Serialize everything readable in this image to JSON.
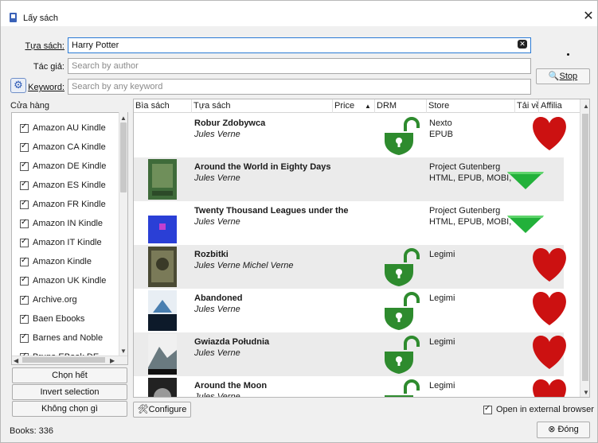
{
  "window": {
    "title": "Lấy sách"
  },
  "search": {
    "title_label": "Tựa sách:",
    "title_value": "Harry Potter",
    "author_label": "Tác giả:",
    "author_placeholder": "Search by author",
    "keyword_label": "Keyword:",
    "keyword_placeholder": "Search by any keyword",
    "stop_label": "Stop"
  },
  "stores": {
    "title": "Cửa hàng",
    "items": [
      {
        "label": "Amazon AU Kindle",
        "checked": true
      },
      {
        "label": "Amazon CA Kindle",
        "checked": true
      },
      {
        "label": "Amazon DE Kindle",
        "checked": true
      },
      {
        "label": "Amazon ES Kindle",
        "checked": true
      },
      {
        "label": "Amazon FR Kindle",
        "checked": true
      },
      {
        "label": "Amazon IN Kindle",
        "checked": true
      },
      {
        "label": "Amazon IT Kindle",
        "checked": true
      },
      {
        "label": "Amazon Kindle",
        "checked": true
      },
      {
        "label": "Amazon UK Kindle",
        "checked": true
      },
      {
        "label": "Archive.org",
        "checked": true
      },
      {
        "label": "Baen Ebooks",
        "checked": true
      },
      {
        "label": "Barnes and Noble",
        "checked": true
      },
      {
        "label": "Bruna EBook DE",
        "checked": true
      }
    ],
    "select_all": "Chọn hết",
    "invert_selection": "Invert selection",
    "select_none": "Không chọn gì"
  },
  "results": {
    "columns": [
      "Bìa sách",
      "Tựa sách",
      "Price",
      "DRM",
      "Store",
      "Tải về",
      "Affilia"
    ],
    "rows": [
      {
        "title": "Robur Zdobywca",
        "author": "Jules Verne",
        "store": "Nexto",
        "formats": "EPUB",
        "drm": "unlocked",
        "affiliate": true,
        "download": false,
        "cover": "none"
      },
      {
        "title": "Around the World in Eighty Days",
        "author": "Jules Verne",
        "store": "Project Gutenberg",
        "formats": "HTML, EPUB, MOBI, TXT",
        "drm": "none",
        "affiliate": false,
        "download": true,
        "cover": "green"
      },
      {
        "title": "Twenty Thousand Leagues under the",
        "author": "Jules Verne",
        "store": "Project Gutenberg",
        "formats": "HTML, EPUB, MOBI, TXT",
        "drm": "none",
        "affiliate": false,
        "download": true,
        "cover": "blue"
      },
      {
        "title": "Rozbitki",
        "author": "Jules Verne Michel Verne",
        "store": "Legimi",
        "formats": "",
        "drm": "unlocked",
        "affiliate": true,
        "download": false,
        "cover": "olive"
      },
      {
        "title": "Abandoned",
        "author": "Jules Verne",
        "store": "Legimi",
        "formats": "",
        "drm": "unlocked",
        "affiliate": true,
        "download": false,
        "cover": "sea"
      },
      {
        "title": "Gwiazda Południa",
        "author": "Jules Verne",
        "store": "Legimi",
        "formats": "",
        "drm": "unlocked",
        "affiliate": true,
        "download": false,
        "cover": "mountain"
      },
      {
        "title": "Around the Moon",
        "author": "Jules Verne",
        "store": "Legimi",
        "formats": "",
        "drm": "unlocked",
        "affiliate": true,
        "download": false,
        "cover": "moon"
      }
    ]
  },
  "footer": {
    "configure": "Configure",
    "open_external": "Open in external browser",
    "close": "Đóng",
    "books_count": "Books:  336"
  },
  "colors": {
    "accent": "#2a7ad5",
    "drm_green": "#2e8b2e",
    "heart_red": "#cc1111"
  }
}
